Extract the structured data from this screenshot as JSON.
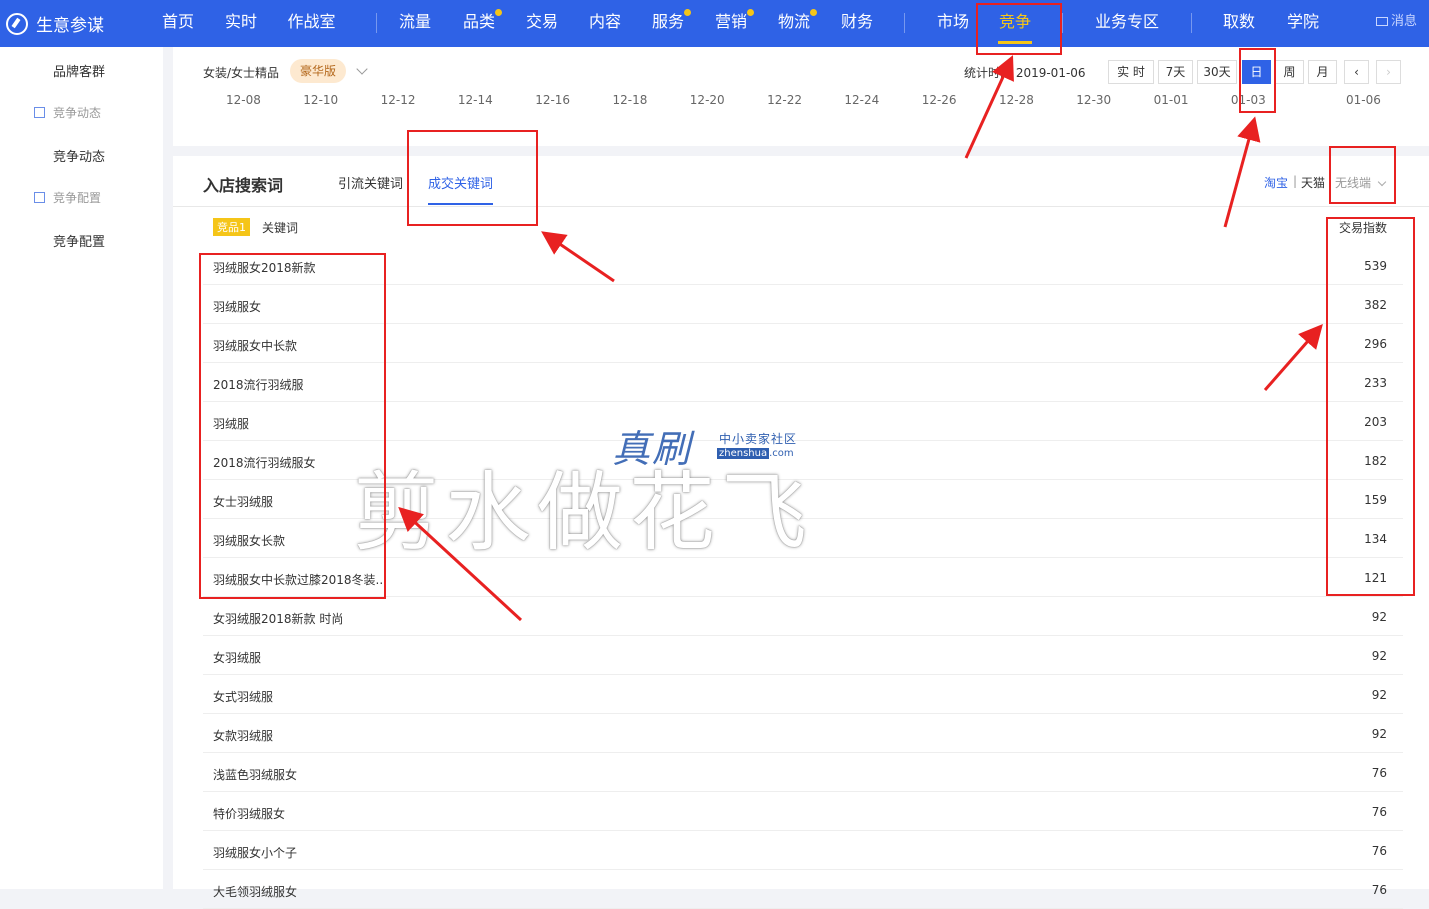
{
  "app": {
    "name": "生意参谋"
  },
  "nav": {
    "items": [
      {
        "label": "首页",
        "dot": false
      },
      {
        "label": "实时",
        "dot": false
      },
      {
        "label": "作战室",
        "dot": false
      },
      {
        "label": "流量",
        "dot": false
      },
      {
        "label": "品类",
        "dot": true
      },
      {
        "label": "交易",
        "dot": false
      },
      {
        "label": "内容",
        "dot": false
      },
      {
        "label": "服务",
        "dot": true
      },
      {
        "label": "营销",
        "dot": true
      },
      {
        "label": "物流",
        "dot": true
      },
      {
        "label": "财务",
        "dot": false
      },
      {
        "label": "市场",
        "dot": false
      },
      {
        "label": "竞争",
        "dot": false,
        "active": true
      },
      {
        "label": "业务专区",
        "dot": false
      },
      {
        "label": "取数",
        "dot": false
      },
      {
        "label": "学院",
        "dot": false
      }
    ],
    "message": "消息"
  },
  "sidebar": {
    "items": [
      {
        "label": "品牌客群",
        "type": "main"
      },
      {
        "label": "竞争动态",
        "type": "section"
      },
      {
        "label": "竞争动态",
        "type": "main"
      },
      {
        "label": "竞争配置",
        "type": "section"
      },
      {
        "label": "竞争配置",
        "type": "main"
      }
    ]
  },
  "top_panel": {
    "category": "女装/女士精品",
    "edition_badge": "豪华版",
    "stat_time": "统计时间 2019-01-06",
    "time_buttons": [
      "实 时",
      "7天",
      "30天",
      "日",
      "周",
      "月"
    ],
    "active_time": "日",
    "x_axis_dates": [
      "12-08",
      "12-10",
      "12-12",
      "12-14",
      "12-16",
      "12-18",
      "12-20",
      "12-22",
      "12-24",
      "12-26",
      "12-28",
      "12-30",
      "01-01",
      "01-03",
      "01-06"
    ]
  },
  "main_panel": {
    "title": "入店搜索词",
    "tabs": [
      {
        "label": "引流关键词",
        "active": false
      },
      {
        "label": "成交关键词",
        "active": true
      }
    ],
    "platform": {
      "taobao": "淘宝",
      "sep": "|",
      "tmall": "天猫",
      "device": "无线端"
    },
    "table_header": {
      "badge": "竞品1",
      "keyword": "关键词",
      "index": "交易指数"
    },
    "rows": [
      {
        "keyword": "羽绒服女2018新款",
        "index": "539"
      },
      {
        "keyword": "羽绒服女",
        "index": "382"
      },
      {
        "keyword": "羽绒服女中长款",
        "index": "296"
      },
      {
        "keyword": "2018流行羽绒服",
        "index": "233"
      },
      {
        "keyword": "羽绒服",
        "index": "203"
      },
      {
        "keyword": "2018流行羽绒服女",
        "index": "182"
      },
      {
        "keyword": "女士羽绒服",
        "index": "159"
      },
      {
        "keyword": "羽绒服女长款",
        "index": "134"
      },
      {
        "keyword": "羽绒服女中长款过膝2018冬装...",
        "index": "121"
      },
      {
        "keyword": "女羽绒服2018新款 时尚",
        "index": "92"
      },
      {
        "keyword": "女羽绒服",
        "index": "92"
      },
      {
        "keyword": "女式羽绒服",
        "index": "92"
      },
      {
        "keyword": "女款羽绒服",
        "index": "92"
      },
      {
        "keyword": "浅蓝色羽绒服女",
        "index": "76"
      },
      {
        "keyword": "特价羽绒服女",
        "index": "76"
      },
      {
        "keyword": "羽绒服女小个子",
        "index": "76"
      },
      {
        "keyword": "大毛领羽绒服女",
        "index": "76"
      }
    ]
  },
  "watermark": {
    "logo": "真刷",
    "tagline": "中小卖家社区",
    "domain_name": "zhenshua",
    "domain_suffix": ".com",
    "overlay_text": "剪水做花飞"
  },
  "colors": {
    "primary": "#2f62e6",
    "accent": "#f5c518",
    "annotation": "#e82121"
  }
}
